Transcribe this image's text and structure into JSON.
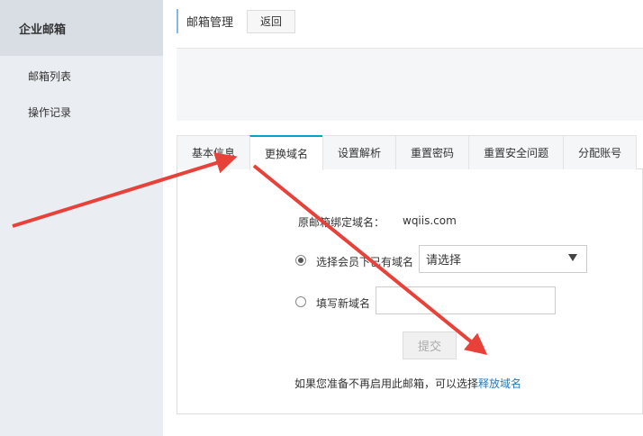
{
  "sidebar": {
    "title": "企业邮箱",
    "items": [
      {
        "label": "邮箱列表"
      },
      {
        "label": "操作记录"
      }
    ]
  },
  "header": {
    "title": "邮箱管理",
    "back_label": "返回"
  },
  "tabs": [
    {
      "label": "基本信息",
      "active": false
    },
    {
      "label": "更换域名",
      "active": true
    },
    {
      "label": "设置解析",
      "active": false
    },
    {
      "label": "重置密码",
      "active": false
    },
    {
      "label": "重置安全问题",
      "active": false
    },
    {
      "label": "分配账号",
      "active": false
    }
  ],
  "form": {
    "original_domain_label": "原邮箱绑定域名：",
    "original_domain_value": "wqiis.com",
    "option_existing_label": "选择会员下已有域名",
    "option_existing_checked": true,
    "select_value": "请选择",
    "option_new_label": "填写新域名",
    "option_new_checked": false,
    "new_domain_value": "",
    "submit_label": "提交"
  },
  "release": {
    "note": "如果您准备不再启用此邮箱，可以选择",
    "link": "释放域名"
  },
  "colors": {
    "arrow": "#e8413a",
    "tab_accent": "#00a2ca",
    "link": "#2a7ab8",
    "sidebar_bg": "#eaedf1"
  }
}
